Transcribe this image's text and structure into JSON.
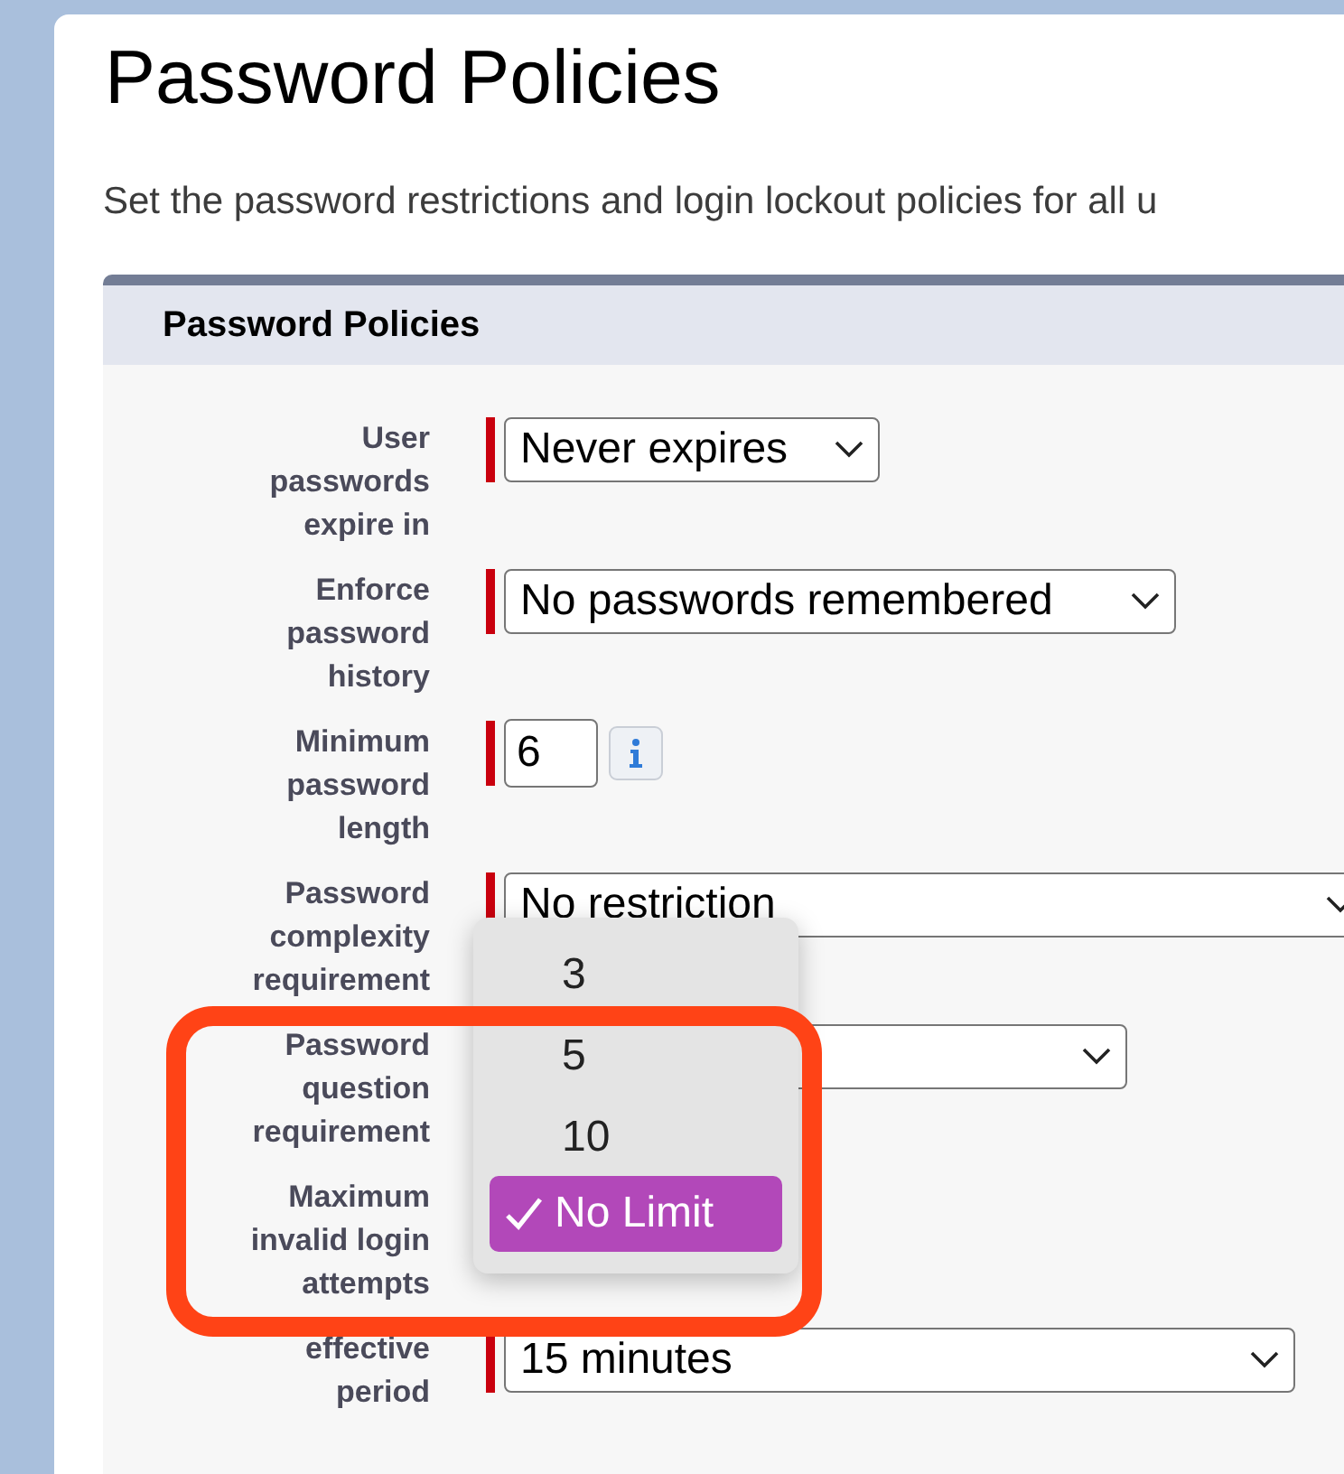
{
  "page": {
    "title": "Password Policies",
    "description": "Set the password restrictions and login lockout policies for all u"
  },
  "section": {
    "title": "Password Policies",
    "fields": [
      {
        "label": "User passwords expire in",
        "kind": "select",
        "value": "Never expires",
        "required": true
      },
      {
        "label": "Enforce password history",
        "kind": "select",
        "value": "No passwords remembered",
        "required": true
      },
      {
        "label": "Minimum password length",
        "kind": "input",
        "value": "6",
        "required": true
      },
      {
        "label": "Password complexity requirement",
        "kind": "select",
        "value": "No restriction",
        "required": true
      },
      {
        "label": "Password question requirement",
        "kind": "select"
      },
      {
        "label": "Maximum invalid login attempts",
        "kind": "none"
      },
      {
        "label": "effective period",
        "kind": "select",
        "value": "15 minutes",
        "required": true
      }
    ]
  },
  "dropdown": {
    "options": [
      {
        "label": "3",
        "selected": false
      },
      {
        "label": "5",
        "selected": false
      },
      {
        "label": "10",
        "selected": false
      },
      {
        "label": "No Limit",
        "selected": true
      }
    ]
  }
}
